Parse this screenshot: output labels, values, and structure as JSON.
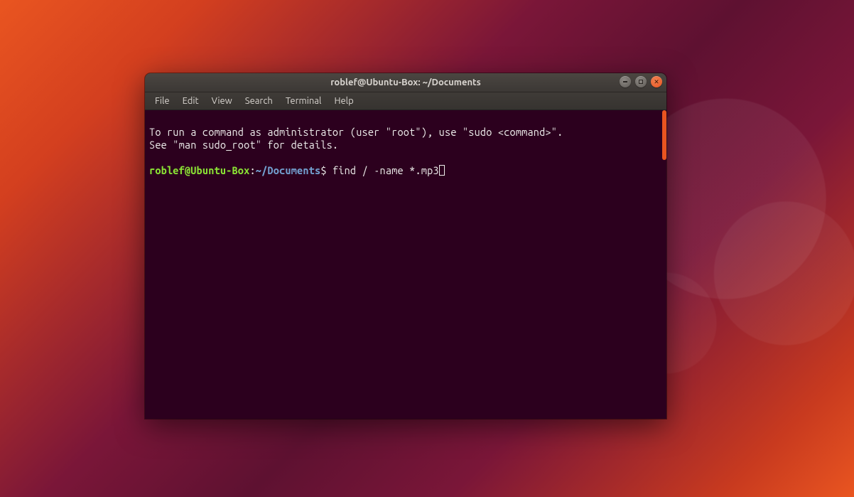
{
  "colors": {
    "accent": "#e95420",
    "terminal_bg": "#2c001e",
    "prompt_user": "#8ae234",
    "prompt_path": "#729fcf",
    "text": "#eeeeec"
  },
  "window": {
    "title": "roblef@Ubuntu-Box: ~/Documents"
  },
  "menubar": {
    "items": [
      "File",
      "Edit",
      "View",
      "Search",
      "Terminal",
      "Help"
    ]
  },
  "terminal": {
    "motd_line1": "To run a command as administrator (user \"root\"), use \"sudo <command>\".",
    "motd_line2": "See \"man sudo_root\" for details.",
    "prompt": {
      "user_host": "roblef@Ubuntu-Box",
      "sep1": ":",
      "path": "~/Documents",
      "sigil": "$"
    },
    "command": "find / -name *.mp3"
  },
  "icons": {
    "minimize": "minimize-icon",
    "maximize": "maximize-icon",
    "close": "close-icon"
  }
}
